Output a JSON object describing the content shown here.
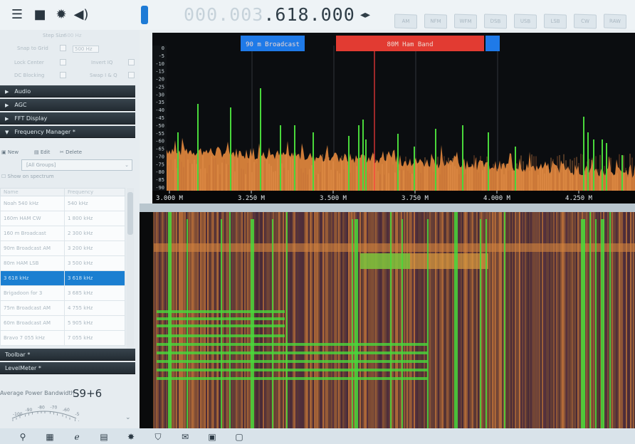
{
  "toolbar": {
    "frequency": "000.003.618.000",
    "freq_dim": "000.003",
    "freq_lit": ".618.000",
    "arrows": "◂▸",
    "icons": [
      "menu-icon",
      "stop-icon",
      "settings-icon",
      "volume-icon"
    ],
    "mode_buttons": [
      "AM",
      "NFM",
      "WFM",
      "DSB",
      "USB",
      "LSB",
      "CW",
      "RAW"
    ]
  },
  "left_panel": {
    "options": [
      {
        "label": "Step Size",
        "value": "500 Hz"
      },
      {
        "label": "Snap to Grid",
        "value": "500 Hz"
      },
      {
        "label": "Lock Center",
        "extra": "Invert IQ"
      },
      {
        "label": "DC Blocking",
        "extra": "Swap I & Q"
      }
    ],
    "sections_top": [
      "Audio",
      "AGC",
      "FFT Display",
      "Frequency Manager *"
    ],
    "fm_tools": {
      "new": "New",
      "edit": "Edit",
      "delete": "Delete"
    },
    "fm_combo": "[All Groups]",
    "fm_show": "Show on spectrum",
    "table_headers": [
      "Name",
      "Frequency"
    ],
    "table_rows": [
      {
        "name": "Noah 540 kHz",
        "freq": "540 kHz"
      },
      {
        "name": "160m HAM CW",
        "freq": "1 800 kHz"
      },
      {
        "name": "160 m Broadcast",
        "freq": "2 300 kHz"
      },
      {
        "name": "90m Broadcast AM",
        "freq": "3 200 kHz"
      },
      {
        "name": "80m HAM LSB",
        "freq": "3 500 kHz"
      },
      {
        "name": "3 618 kHz",
        "freq": "3 618 kHz",
        "selected": true
      },
      {
        "name": "Brigadoon for 3",
        "freq": "3 685 kHz"
      },
      {
        "name": "75m Broadcast AM",
        "freq": "4 755 kHz"
      },
      {
        "name": "60m Broadcast AM",
        "freq": "5 905 kHz"
      },
      {
        "name": "Bravo 7 055 kHz",
        "freq": "7 055 kHz"
      }
    ],
    "sections_bottom": [
      "Toolbar *",
      "LevelMeter *"
    ],
    "power_label": "Average Power Bandwidth",
    "power_value": "S9+6",
    "meter_ticks": [
      "-100",
      "-90",
      "-80",
      "-70",
      "-60",
      "-50"
    ]
  },
  "spectrum": {
    "bands": [
      {
        "label": "90 m Broadcast",
        "color": "#1f7ae8"
      },
      {
        "label": "80M Ham Band",
        "color": "#e23b32"
      },
      {
        "label": "",
        "color": "#1f7ae8"
      }
    ],
    "y_ticks": [
      "0",
      "-5",
      "-10",
      "-15",
      "-20",
      "-25",
      "-30",
      "-35",
      "-40",
      "-45",
      "-50",
      "-55",
      "-60",
      "-65",
      "-70",
      "-75",
      "-80",
      "-85",
      "-90"
    ],
    "x_ticks": [
      "3.000 M",
      "3.250 M",
      "3.500 M",
      "3.750 M",
      "4.000 M",
      "4.250 M"
    ],
    "tuned_marker": "3.618 M",
    "colors": {
      "fill": "#e58a3e",
      "signal": "#49d83b",
      "marker": "#ff3b3b"
    }
  },
  "taskbar": {
    "icons": [
      "search-icon",
      "task-view-icon",
      "edge-icon",
      "calculator-icon",
      "settings-icon",
      "store-icon",
      "mail-icon",
      "explorer-icon",
      "app-icon"
    ]
  }
}
